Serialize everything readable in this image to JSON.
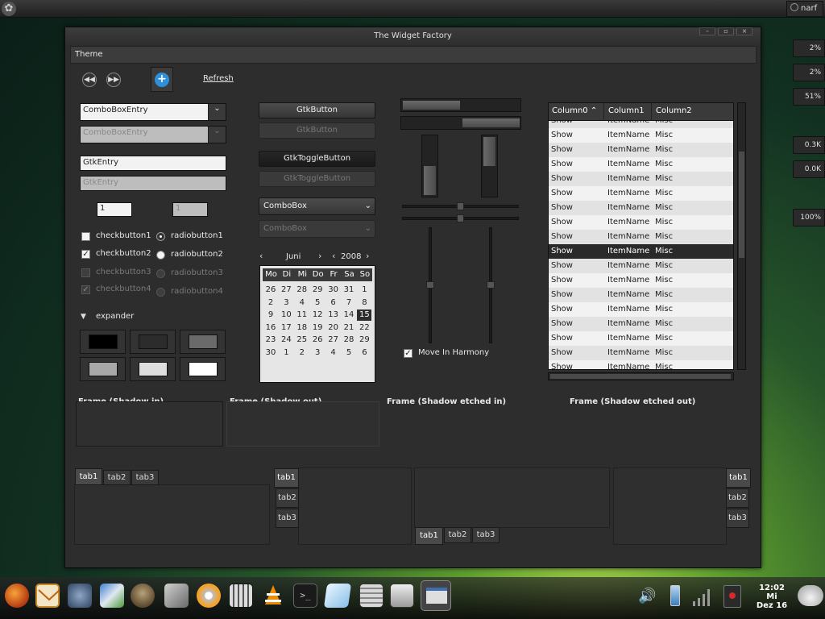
{
  "panel": {
    "user": "narf"
  },
  "meters": [
    "2%",
    "2%",
    "51%",
    "0.3K",
    "0.0K",
    "100%"
  ],
  "window": {
    "title": "The Widget Factory"
  },
  "menu": {
    "theme": "Theme"
  },
  "toolbar": {
    "refresh": "Refresh"
  },
  "combos": {
    "entry1": "ComboBoxEntry",
    "entry2": "ComboBoxEntry",
    "combo1": "ComboBox",
    "combo2": "ComboBox"
  },
  "entries": {
    "entry1": "GtkEntry",
    "entry2": "GtkEntry",
    "spin1": "1",
    "spin2": "1"
  },
  "buttons": {
    "button1": "GtkButton",
    "button2": "GtkButton",
    "toggle1": "GtkToggleButton",
    "toggle2": "GtkToggleButton"
  },
  "checks": [
    {
      "label": "checkbutton1",
      "checked": false
    },
    {
      "label": "checkbutton2",
      "checked": true
    },
    {
      "label": "checkbutton3",
      "checked": false
    },
    {
      "label": "checkbutton4",
      "checked": true
    }
  ],
  "radios": [
    "radiobutton1",
    "radiobutton2",
    "radiobutton3",
    "radiobutton4"
  ],
  "expander": "expander",
  "calendar": {
    "month": "Juni",
    "year": "2008",
    "days": [
      "Mo",
      "Di",
      "Mi",
      "Do",
      "Fr",
      "Sa",
      "So"
    ],
    "rows": [
      [
        "26",
        "27",
        "28",
        "29",
        "30",
        "31",
        "1"
      ],
      [
        "2",
        "3",
        "4",
        "5",
        "6",
        "7",
        "8"
      ],
      [
        "9",
        "10",
        "11",
        "12",
        "13",
        "14",
        "15"
      ],
      [
        "16",
        "17",
        "18",
        "19",
        "20",
        "21",
        "22"
      ],
      [
        "23",
        "24",
        "25",
        "26",
        "27",
        "28",
        "29"
      ],
      [
        "30",
        "1",
        "2",
        "3",
        "4",
        "5",
        "6"
      ]
    ],
    "selected": "15"
  },
  "harmony": "Move In Harmony",
  "list": {
    "columns": [
      "Column0",
      "Column1",
      "Column2"
    ],
    "row": [
      "Show",
      "ItemName",
      "Misc"
    ],
    "count": 18,
    "selected_index": 8
  },
  "frames": [
    "Frame (Shadow in)",
    "Frame (Shadow out)",
    "Frame (Shadow etched in)",
    "Frame (Shadow etched out)"
  ],
  "tabs": [
    "tab1",
    "tab2",
    "tab3"
  ],
  "clock": {
    "time": "12:02",
    "day": "Mi",
    "date": "Dez 16"
  }
}
